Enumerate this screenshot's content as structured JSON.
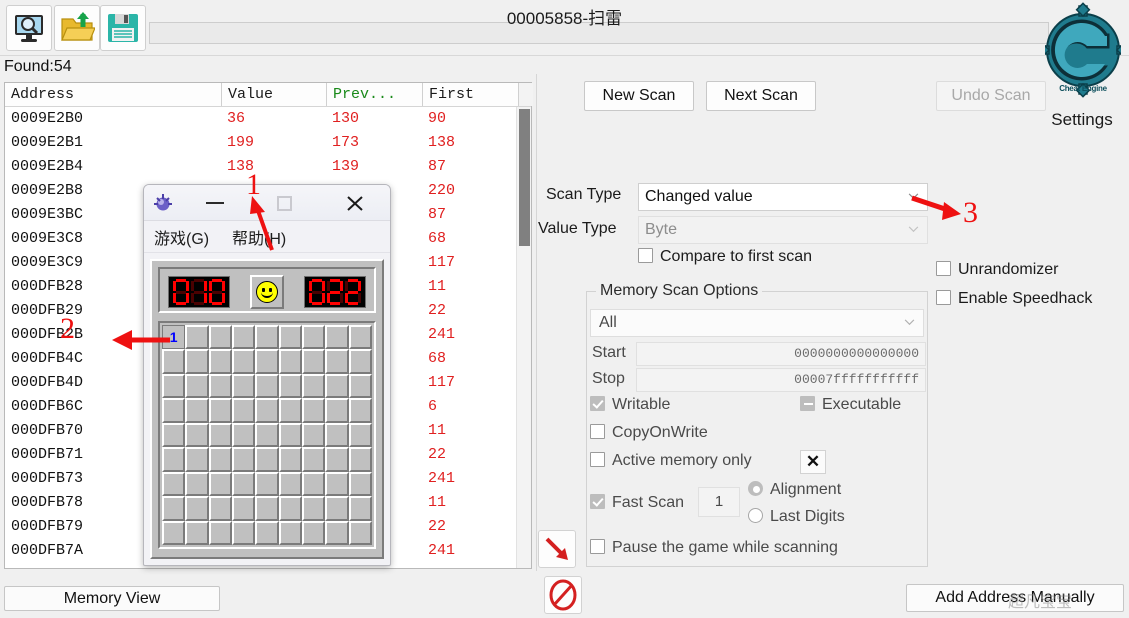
{
  "window": {
    "title": "00005858-扫雷",
    "found_label": "Found:54"
  },
  "toolbar": {
    "icons": [
      "process-select-icon",
      "open-file-icon",
      "save-file-icon"
    ],
    "address_bar_value": ""
  },
  "logo": {
    "brand": "Cheat Engine",
    "settings_label": "Settings"
  },
  "table": {
    "columns": [
      "Address",
      "Value",
      "Prev...",
      "First"
    ],
    "rows": [
      {
        "address": "0009E2B0",
        "value": "36",
        "prev": "130",
        "first": "90"
      },
      {
        "address": "0009E2B1",
        "value": "199",
        "prev": "173",
        "first": "138"
      },
      {
        "address": "0009E2B4",
        "value": "138",
        "prev": "139",
        "first": "87"
      },
      {
        "address": "0009E2B8",
        "value": "",
        "prev": "",
        "first": "220"
      },
      {
        "address": "0009E3BC",
        "value": "",
        "prev": "",
        "first": "87"
      },
      {
        "address": "0009E3C8",
        "value": "",
        "prev": "",
        "first": "68"
      },
      {
        "address": "0009E3C9",
        "value": "",
        "prev": "",
        "first": "117"
      },
      {
        "address": "000DFB28",
        "value": "",
        "prev": "",
        "first": "11"
      },
      {
        "address": "000DFB29",
        "value": "",
        "prev": "",
        "first": "22"
      },
      {
        "address": "000DFB2B",
        "value": "",
        "prev": "",
        "first": "241"
      },
      {
        "address": "000DFB4C",
        "value": "",
        "prev": "",
        "first": "68"
      },
      {
        "address": "000DFB4D",
        "value": "",
        "prev": "",
        "first": "117"
      },
      {
        "address": "000DFB6C",
        "value": "",
        "prev": "",
        "first": "6"
      },
      {
        "address": "000DFB70",
        "value": "",
        "prev": "",
        "first": "11"
      },
      {
        "address": "000DFB71",
        "value": "",
        "prev": "",
        "first": "22"
      },
      {
        "address": "000DFB73",
        "value": "",
        "prev": "",
        "first": "241"
      },
      {
        "address": "000DFB78",
        "value": "",
        "prev": "",
        "first": "11"
      },
      {
        "address": "000DFB79",
        "value": "",
        "prev": "",
        "first": "22"
      },
      {
        "address": "000DFB7A",
        "value": "",
        "prev": "",
        "first": "241"
      }
    ]
  },
  "scan": {
    "new_scan": "New Scan",
    "next_scan": "Next Scan",
    "undo_scan": "Undo Scan",
    "scan_type_label": "Scan Type",
    "scan_type_value": "Changed value",
    "value_type_label": "Value Type",
    "value_type_value": "Byte",
    "compare_first": "Compare to first scan",
    "compare_first_checked": false
  },
  "right_options": {
    "unrandomizer": "Unrandomizer",
    "unrandomizer_checked": false,
    "speedhack": "Enable Speedhack",
    "speedhack_checked": false
  },
  "memory_scan_options": {
    "title": "Memory Scan Options",
    "region": "All",
    "start_label": "Start",
    "start_value": "0000000000000000",
    "stop_label": "Stop",
    "stop_value": "00007fffffffffff",
    "writable": "Writable",
    "writable_checked": true,
    "executable": "Executable",
    "executable_state": "partial",
    "copyonwrite": "CopyOnWrite",
    "copyonwrite_checked": false,
    "active_memory_only": "Active memory only",
    "active_memory_only_checked": false,
    "clear_mark": "✕",
    "fast_scan": "Fast Scan",
    "fast_scan_checked": true,
    "fast_scan_value": "1",
    "alignment": "Alignment",
    "alignment_selected": true,
    "last_digits": "Last Digits",
    "last_digits_selected": false,
    "pause_game": "Pause the game while scanning",
    "pause_game_checked": false
  },
  "bottom": {
    "memory_view": "Memory View",
    "add_address": "Add Address Manually",
    "watermark": "超凡宝宝",
    "arrow_button": "red-arrow-icon",
    "stop_button": "no-entry-icon"
  },
  "minesweeper": {
    "title_icon": "minesweeper-icon",
    "menu_game": "游戏(G)",
    "menu_help": "帮助(H)",
    "minimize": "—",
    "maximize": "□",
    "close": "✕",
    "mine_counter": "010",
    "timer": "022",
    "grid_rows": 9,
    "grid_cols": 9,
    "revealed_cell": {
      "row": 0,
      "col": 0,
      "label": "1"
    }
  },
  "annotations": [
    {
      "id": "1",
      "label": "1"
    },
    {
      "id": "2",
      "label": "2"
    },
    {
      "id": "3",
      "label": "3"
    }
  ],
  "colors": {
    "accent_red": "#e02020",
    "prev_header_green": "#1a8a1a",
    "annotation_red": "#ee1111",
    "ce_teal": "#2e8ca0"
  }
}
